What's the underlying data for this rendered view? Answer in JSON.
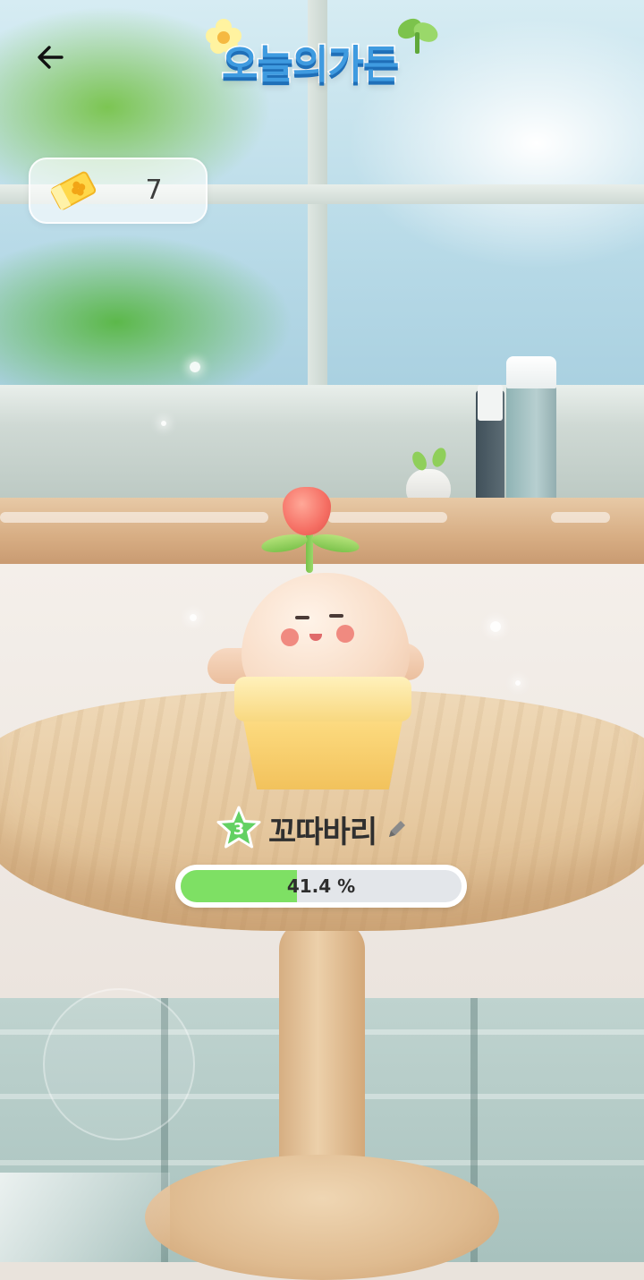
{
  "header": {
    "logo_text": "오늘의가든",
    "back_icon": "arrow-left-icon"
  },
  "currency": {
    "icon": "clover-ticket-icon",
    "count": "7"
  },
  "plant": {
    "level": "3",
    "name": "꼬따바리",
    "edit_icon": "pencil-icon",
    "growth_percent": 41.4,
    "growth_label": "41.4 %"
  },
  "colors": {
    "progress_fill": "#7ee064",
    "progress_track": "#e3e6ea",
    "logo_blue": "#3f9be0",
    "level_badge": "#63d163"
  }
}
